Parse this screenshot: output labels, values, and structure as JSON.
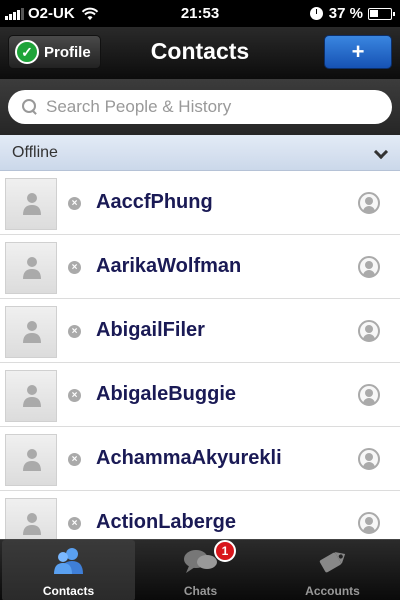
{
  "status_bar": {
    "carrier": "O2-UK",
    "time": "21:53",
    "battery": "37 %"
  },
  "nav": {
    "profile_label": "Profile",
    "title": "Contacts",
    "add_label": "+"
  },
  "search": {
    "placeholder": "Search People & History"
  },
  "section": {
    "label": "Offline"
  },
  "contacts": [
    {
      "name": "AaccfPhung"
    },
    {
      "name": "AarikaWolfman"
    },
    {
      "name": "AbigailFiler"
    },
    {
      "name": "AbigaleBuggie"
    },
    {
      "name": "AchammaAkyurekli"
    },
    {
      "name": "ActionLaberge"
    }
  ],
  "tabs": [
    {
      "label": "Contacts",
      "icon": "contacts-icon",
      "active": true
    },
    {
      "label": "Chats",
      "icon": "chats-icon",
      "badge": "1"
    },
    {
      "label": "Accounts",
      "icon": "accounts-icon"
    }
  ],
  "colors": {
    "accent_blue": "#1652b4",
    "check_green": "#1fa43a",
    "badge_red": "#d8161c"
  }
}
